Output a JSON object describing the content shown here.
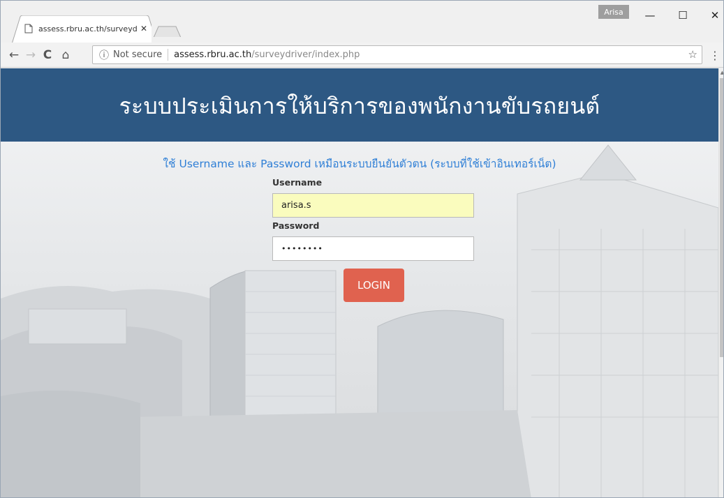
{
  "browser": {
    "tab_title": "assess.rbru.ac.th/surveyd",
    "tab_close": "✕",
    "profile_name": "Arisa",
    "minimize": "—",
    "maximize": "☐",
    "close": "✕",
    "back": "←",
    "forward": "→",
    "reload": "C",
    "home": "⌂",
    "info_icon": "ⓘ",
    "security_text": "Not secure",
    "url_host": "assess.rbru.ac.th",
    "url_path": "/surveydriver/index.php",
    "bookmark": "☆",
    "menu": "⋮"
  },
  "page": {
    "header_title": "ระบบประเมินการให้บริการของพนักงานขับรถยนต์",
    "instruction": "ใช้ Username และ Password เหมือนระบบยืนยันตัวตน (ระบบที่ใช้เข้าอินเทอร์เน็ต)",
    "username_label": "Username",
    "username_value": "arisa.s",
    "password_label": "Password",
    "password_value": "••••••••",
    "login_label": "LOGIN"
  },
  "colors": {
    "header_bg": "#2d5883",
    "instruction_text": "#2f7fd6",
    "login_button": "#e0624f",
    "autofill_bg": "#fafcbe"
  }
}
